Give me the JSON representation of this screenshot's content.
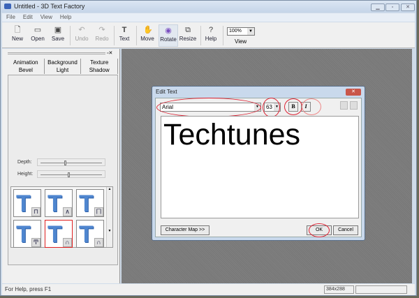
{
  "window": {
    "title": "Untitled - 3D Text Factory",
    "controls": [
      "minimize",
      "maximize",
      "close"
    ]
  },
  "menu": [
    "File",
    "Edit",
    "View",
    "Help"
  ],
  "toolbar": {
    "buttons": [
      {
        "label": "New",
        "icon": "new-file-icon",
        "disabled": false
      },
      {
        "label": "Open",
        "icon": "folder-open-icon",
        "disabled": false
      },
      {
        "label": "Save",
        "icon": "save-disk-icon",
        "disabled": false
      },
      {
        "label": "Undo",
        "icon": "undo-icon",
        "disabled": true
      },
      {
        "label": "Redo",
        "icon": "redo-icon",
        "disabled": true
      },
      {
        "label": "Text",
        "icon": "text-t-icon",
        "disabled": false
      },
      {
        "label": "Move",
        "icon": "hand-icon",
        "disabled": false
      },
      {
        "label": "Rotate",
        "icon": "rotate-icon",
        "disabled": false,
        "active": true
      },
      {
        "label": "Resize",
        "icon": "resize-icon",
        "disabled": false
      },
      {
        "label": "Help",
        "icon": "help-icon",
        "disabled": false
      }
    ],
    "zoom": "100%",
    "view_label": "View"
  },
  "panel": {
    "tabs_row1": [
      "Animation",
      "Background",
      "Texture"
    ],
    "tabs_row2": [
      "Bevel",
      "Light",
      "Shadow"
    ],
    "active_tab": "Bevel",
    "depth_label": "Depth:",
    "height_label": "Height:",
    "depth_value": 0.4,
    "height_value": 0.45,
    "bevel_styles": [
      "⊓",
      "∧",
      "⨅",
      "Ͳ",
      "∩",
      "∩"
    ],
    "selected_bevel": 4
  },
  "dialog": {
    "title": "Edit Text",
    "font": "Arial",
    "size": "63",
    "bold": "B",
    "italic": "I",
    "text": "Techtunes",
    "charmap": "Character Map >>",
    "ok": "OK",
    "cancel": "Cancel"
  },
  "status": {
    "help": "For Help, press F1",
    "dimensions": "384x288"
  }
}
